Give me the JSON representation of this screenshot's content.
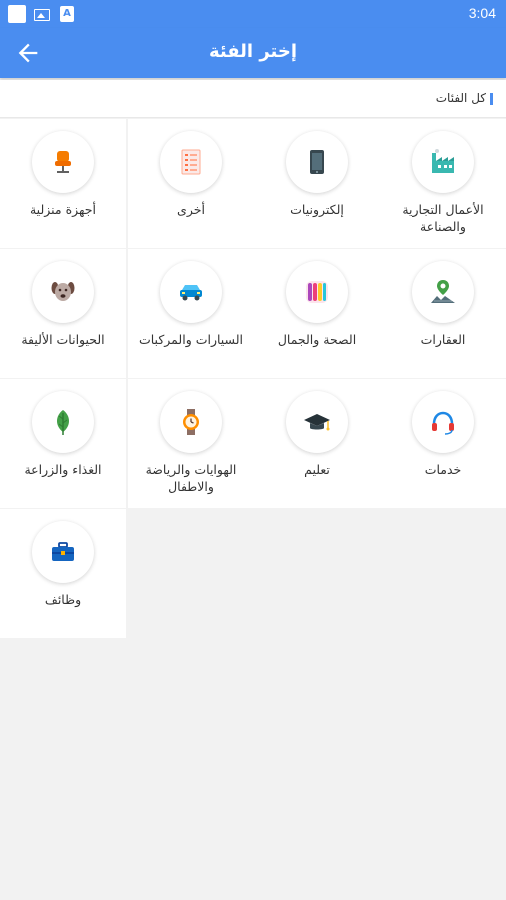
{
  "status_bar": {
    "time": "3:04"
  },
  "app_bar": {
    "title": "إختر الفئة",
    "back_icon": "arrow-back-icon"
  },
  "all_categories": {
    "label": "كل الفئات",
    "accent_color": "#4a8df0"
  },
  "categories": [
    {
      "label": "الأعمال التجارية والصناعة",
      "icon": "factory-icon"
    },
    {
      "label": "إلكترونيات",
      "icon": "smartphone-icon"
    },
    {
      "label": "أخرى",
      "icon": "checklist-icon"
    },
    {
      "label": "أجهزة منزلية",
      "icon": "chair-icon"
    },
    {
      "label": "العقارات",
      "icon": "location-land-icon"
    },
    {
      "label": "الصحة والجمال",
      "icon": "palette-icon"
    },
    {
      "label": "السيارات والمركبات",
      "icon": "car-icon"
    },
    {
      "label": "الحيوانات الأليفة",
      "icon": "dog-icon"
    },
    {
      "label": "خدمات",
      "icon": "headset-icon"
    },
    {
      "label": "تعليم",
      "icon": "graduation-cap-icon"
    },
    {
      "label": "الهوايات والرياضة والاطفال",
      "icon": "watch-icon"
    },
    {
      "label": "الغذاء والزراعة",
      "icon": "leaf-icon"
    },
    {
      "label": "وظائف",
      "icon": "briefcase-icon"
    }
  ],
  "colors": {
    "primary": "#4a8df0",
    "background": "#f2f2f2"
  }
}
